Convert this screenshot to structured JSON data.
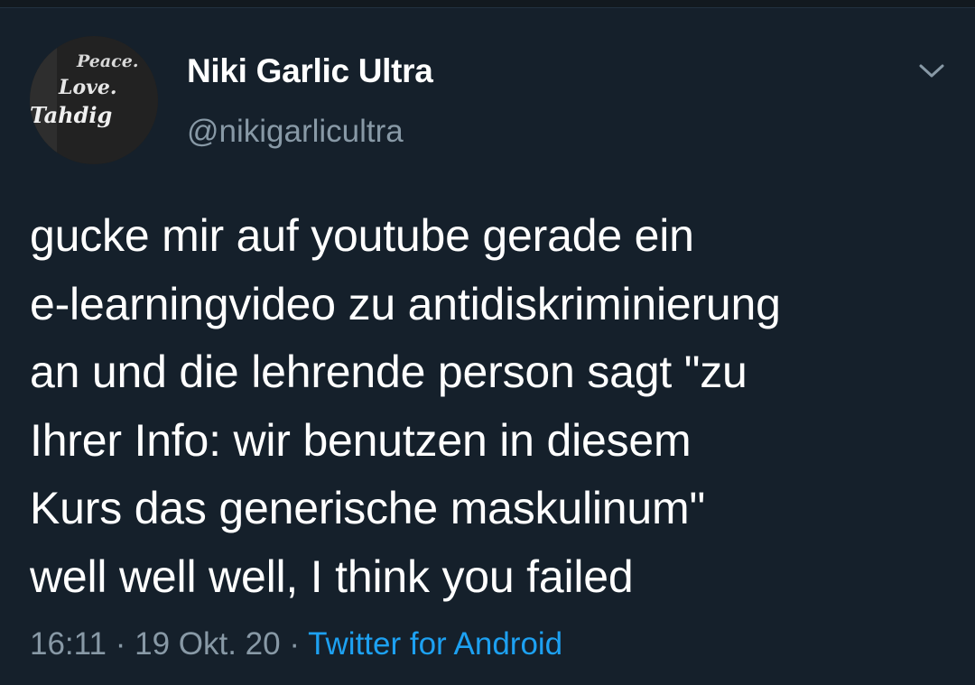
{
  "avatar": {
    "shirt_lines": [
      "Peace.",
      "Love.",
      "Tahdig"
    ]
  },
  "author": {
    "name": "Niki Garlic Ultra",
    "handle": "@nikigarlicultra"
  },
  "tweet": {
    "lines": [
      "gucke mir auf youtube gerade ein",
      "e-learningvideo zu antidiskriminierung",
      "an und die lehrende person sagt \"zu",
      "Ihrer Info: wir benutzen in diesem",
      "Kurs das generische maskulinum\"",
      "well well well, I think you failed"
    ]
  },
  "meta": {
    "time": "16:11",
    "sep1": " · ",
    "date": "19 Okt. 20",
    "sep2": " · ",
    "source": "Twitter for Android"
  },
  "colors": {
    "background": "#15202b",
    "text": "#ffffff",
    "secondary": "#8899a6",
    "link": "#1da1f2"
  },
  "icons": {
    "menu": "chevron-down-icon"
  }
}
